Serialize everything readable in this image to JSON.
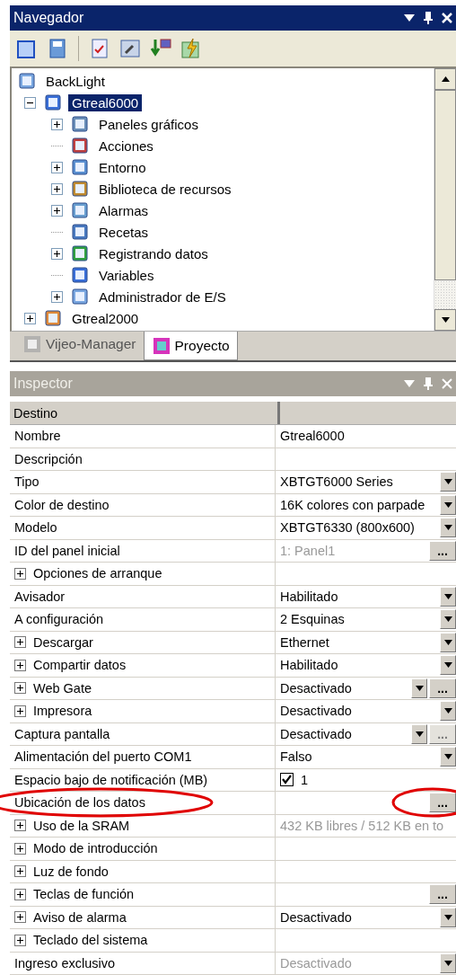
{
  "navigator": {
    "title": "Navegador",
    "tree": [
      {
        "label": "BackLight",
        "selected": false,
        "children": [
          {
            "label": "Gtreal6000",
            "selected": true,
            "expanded": true,
            "children": [
              {
                "label": "Paneles gráficos",
                "selected": false,
                "expanded": false
              },
              {
                "label": "Acciones",
                "selected": false
              },
              {
                "label": "Entorno",
                "selected": false,
                "expanded": false
              },
              {
                "label": "Biblioteca de recursos",
                "selected": false,
                "expanded": false
              },
              {
                "label": "Alarmas",
                "selected": false,
                "expanded": false
              },
              {
                "label": "Recetas",
                "selected": false
              },
              {
                "label": "Registrando datos",
                "selected": false,
                "expanded": false
              },
              {
                "label": "Variables",
                "selected": false
              },
              {
                "label": "Administrador de E/S",
                "selected": false,
                "expanded": false
              }
            ]
          },
          {
            "label": "Gtreal2000",
            "selected": false,
            "expanded": false
          }
        ]
      }
    ],
    "tabs": [
      {
        "label": "Vijeo-Manager",
        "selected": false
      },
      {
        "label": "Proyecto",
        "selected": true
      }
    ]
  },
  "inspector": {
    "title": "Inspector",
    "header": "Destino",
    "rows": [
      {
        "label": "Nombre",
        "value": "Gtreal6000",
        "expandable": false,
        "disabled": false,
        "controls": []
      },
      {
        "label": "Descripción",
        "expandable": false,
        "controls": []
      },
      {
        "label": "Tipo",
        "value": "XBTGT6000 Series",
        "expandable": false,
        "disabled": false,
        "controls": [
          {
            "kind": "dropdown"
          }
        ]
      },
      {
        "label": "Color de destino",
        "value": "16K colores con parpade",
        "expandable": false,
        "disabled": false,
        "controls": [
          {
            "kind": "dropdown"
          }
        ]
      },
      {
        "label": "Modelo",
        "value": "XBTGT6330 (800x600)",
        "expandable": false,
        "disabled": false,
        "controls": [
          {
            "kind": "dropdown"
          }
        ]
      },
      {
        "label": "ID del panel inicial",
        "value": "1: Panel1",
        "expandable": false,
        "disabled": true,
        "controls": [
          {
            "kind": "ellipsis",
            "text": "...",
            "disabled": false
          }
        ]
      },
      {
        "label": "Opciones  de arranque",
        "expandable": true,
        "controls": []
      },
      {
        "label": "Avisador",
        "value": "Habilitado",
        "expandable": false,
        "disabled": false,
        "controls": [
          {
            "kind": "dropdown"
          }
        ]
      },
      {
        "label": "A configuración",
        "value": "2 Esquinas",
        "expandable": false,
        "disabled": false,
        "controls": [
          {
            "kind": "dropdown"
          }
        ]
      },
      {
        "label": "Descargar",
        "value": "Ethernet",
        "expandable": true,
        "disabled": false,
        "controls": [
          {
            "kind": "dropdown"
          }
        ]
      },
      {
        "label": "Compartir datos",
        "value": "Habilitado",
        "expandable": true,
        "disabled": false,
        "controls": [
          {
            "kind": "dropdown"
          }
        ]
      },
      {
        "label": "Web Gate",
        "value": "Desactivado",
        "expandable": true,
        "disabled": false,
        "controls": [
          {
            "kind": "dropdown"
          },
          {
            "kind": "ellipsis",
            "text": "...",
            "disabled": false
          }
        ]
      },
      {
        "label": "Impresora",
        "value": "Desactivado",
        "expandable": true,
        "disabled": false,
        "controls": [
          {
            "kind": "dropdown"
          }
        ]
      },
      {
        "label": "Captura pantalla",
        "value": "Desactivado",
        "expandable": false,
        "disabled": false,
        "controls": [
          {
            "kind": "dropdown"
          },
          {
            "kind": "ellipsis",
            "text": "...",
            "disabled": true
          }
        ]
      },
      {
        "label": "Alimentación del puerto COM1",
        "value": "Falso",
        "expandable": false,
        "disabled": false,
        "controls": [
          {
            "kind": "dropdown"
          }
        ]
      },
      {
        "label": "Espacio bajo de notificación (MB)",
        "value": "1",
        "checked": true,
        "expandable": false,
        "disabled": false,
        "controls": []
      },
      {
        "label": "Ubicación de los datos",
        "expandable": false,
        "controls": [
          {
            "kind": "ellipsis",
            "text": "...",
            "disabled": false
          }
        ]
      },
      {
        "label": "Uso de la SRAM",
        "value": "432 KB libres / 512 KB en to",
        "expandable": true,
        "disabled": true,
        "controls": []
      },
      {
        "label": "Modo de introducción",
        "expandable": true,
        "controls": []
      },
      {
        "label": "Luz de fondo",
        "expandable": true,
        "controls": []
      },
      {
        "label": "Teclas de función",
        "expandable": true,
        "controls": [
          {
            "kind": "ellipsis",
            "text": "...",
            "disabled": false
          }
        ]
      },
      {
        "label": "Aviso de alarma",
        "value": "Desactivado",
        "expandable": true,
        "disabled": false,
        "controls": [
          {
            "kind": "dropdown"
          }
        ]
      },
      {
        "label": "Teclado del sistema",
        "expandable": true,
        "controls": []
      },
      {
        "label": "Ingreso exclusivo",
        "value": "Desactivado",
        "expandable": false,
        "disabled": true,
        "controls": [
          {
            "kind": "dropdown"
          }
        ]
      }
    ]
  }
}
